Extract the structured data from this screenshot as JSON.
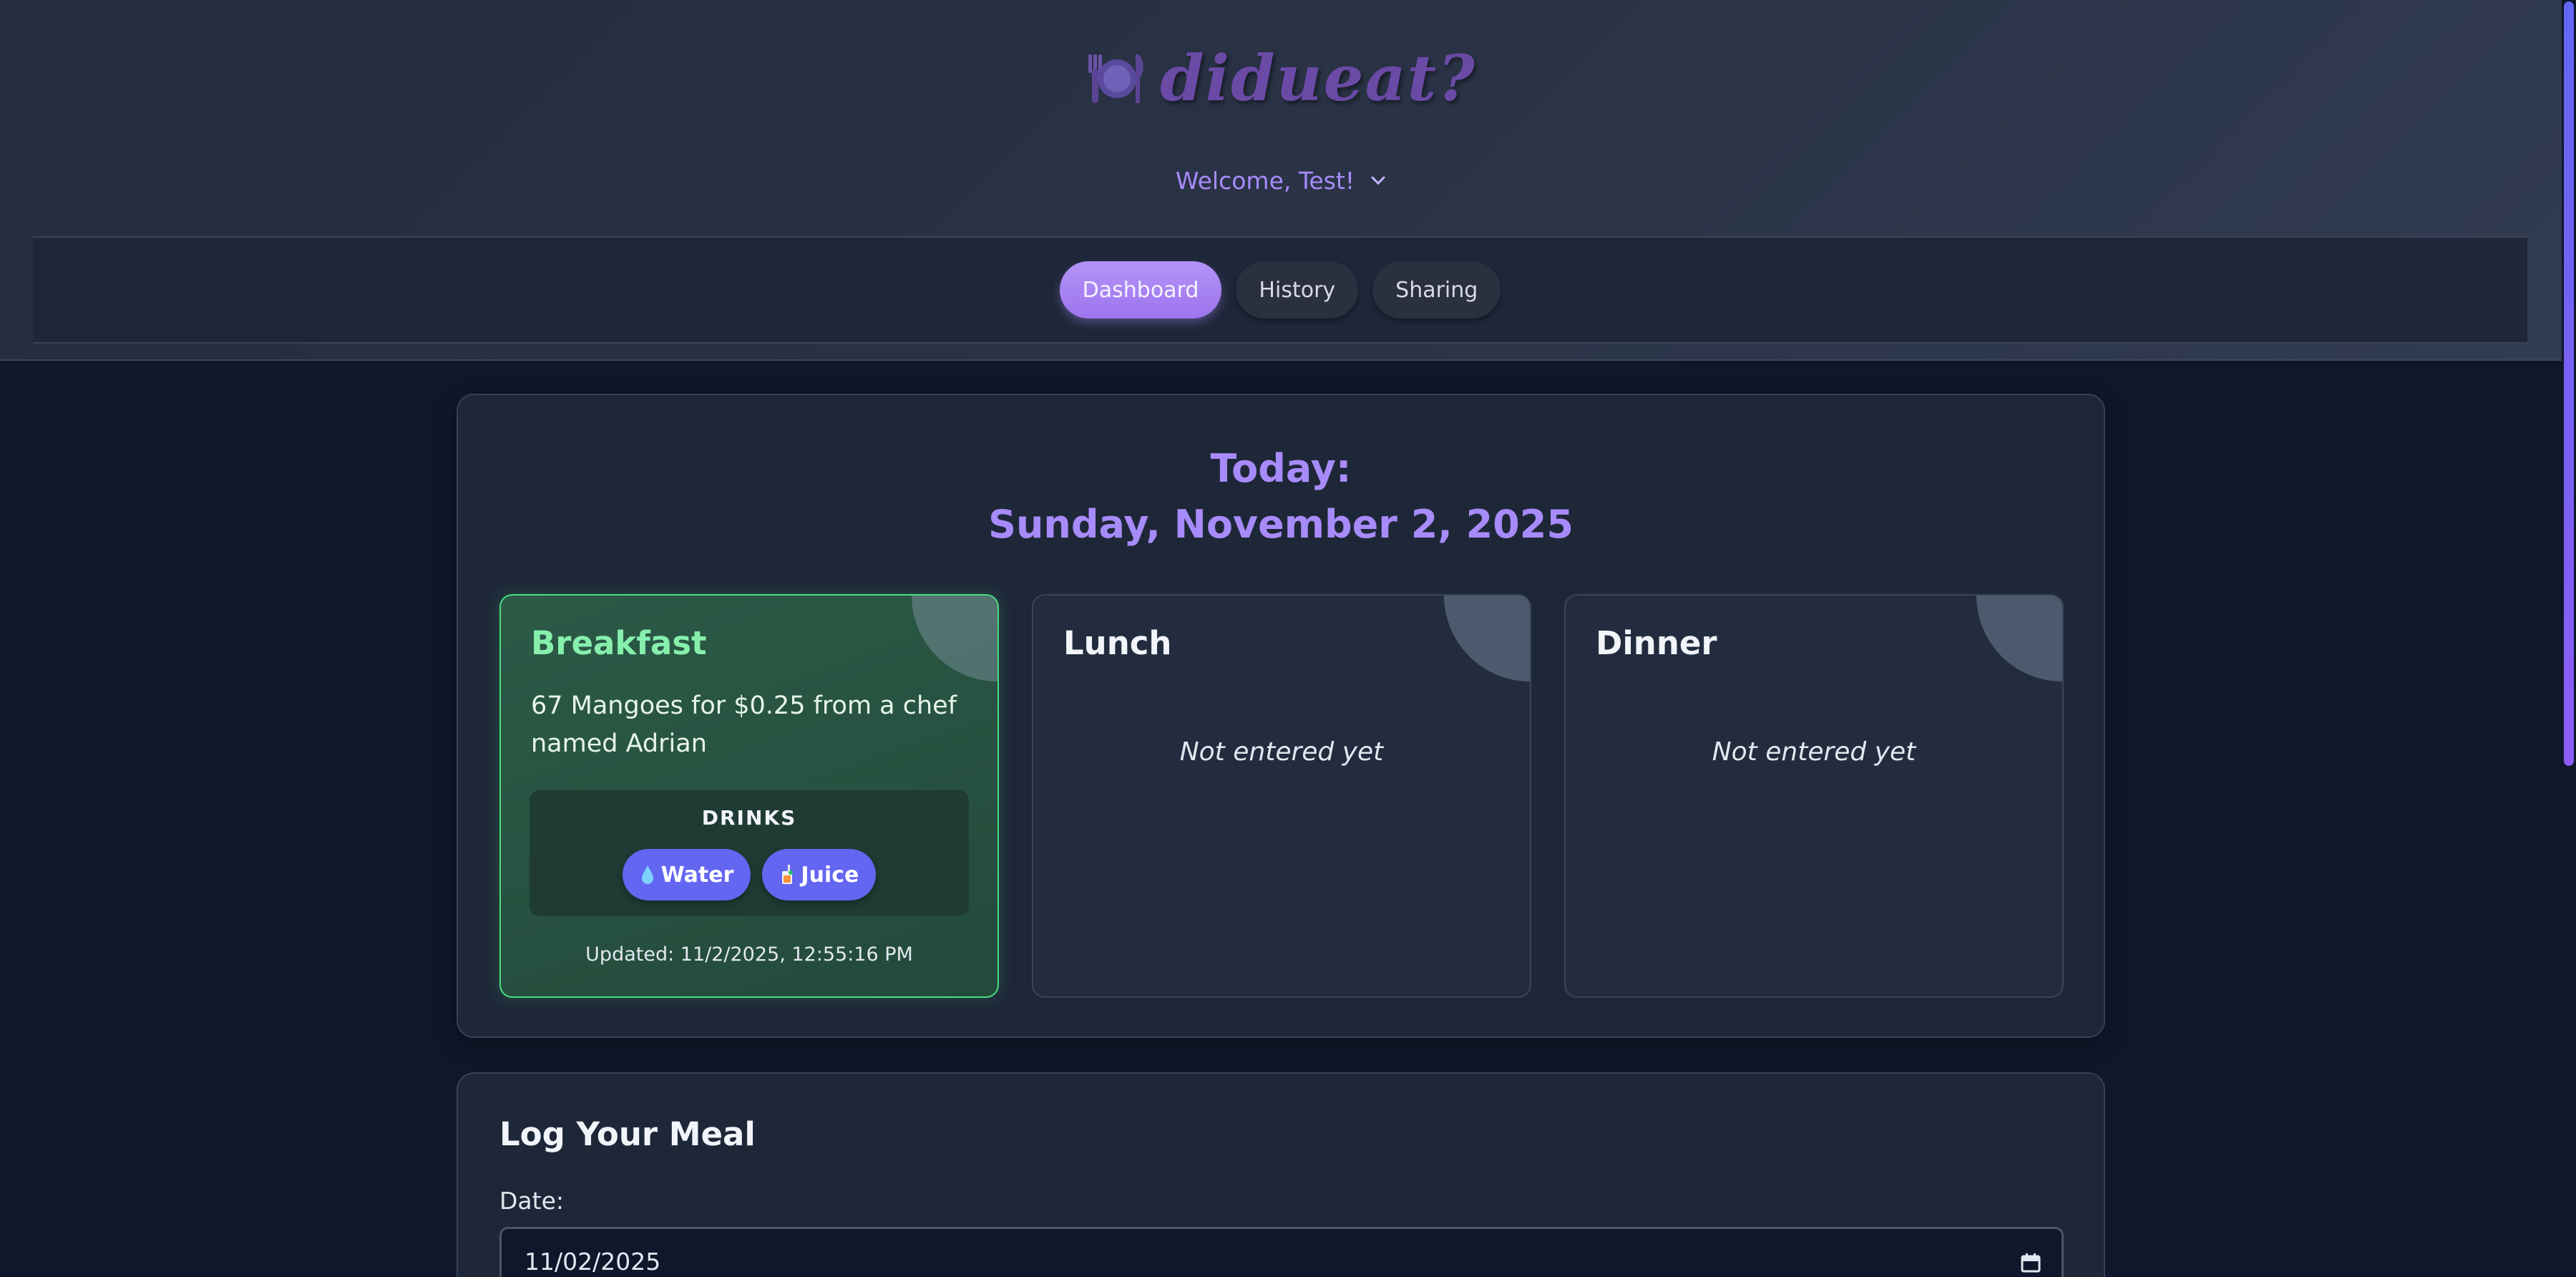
{
  "app": {
    "logo_text": "didueat?",
    "logo_icon": "plate-utensils-icon",
    "welcome": "Welcome, Test!"
  },
  "nav": {
    "tabs": [
      {
        "label": "Dashboard",
        "active": true
      },
      {
        "label": "History",
        "active": false
      },
      {
        "label": "Sharing",
        "active": false
      }
    ]
  },
  "today": {
    "heading": "Today:",
    "date": "Sunday, November 2, 2025",
    "meals": {
      "breakfast": {
        "title": "Breakfast",
        "description": "67 Mangoes for $0.25 from a chef named Adrian",
        "drinks_label": "DRINKS",
        "drinks": [
          {
            "icon": "water-drop-icon",
            "label": "Water"
          },
          {
            "icon": "juice-icon",
            "label": "Juice"
          }
        ],
        "updated": "Updated: 11/2/2025, 12:55:16 PM"
      },
      "lunch": {
        "title": "Lunch",
        "status": "Not entered yet"
      },
      "dinner": {
        "title": "Dinner",
        "status": "Not entered yet"
      }
    }
  },
  "log": {
    "title": "Log Your Meal",
    "date_label": "Date:",
    "date_value": "11/02/2025"
  },
  "colors": {
    "accent": "#a78bfa",
    "filled_meal_border": "#4ade80",
    "drink_pill": "#6366f1",
    "background": "#0f172a"
  }
}
